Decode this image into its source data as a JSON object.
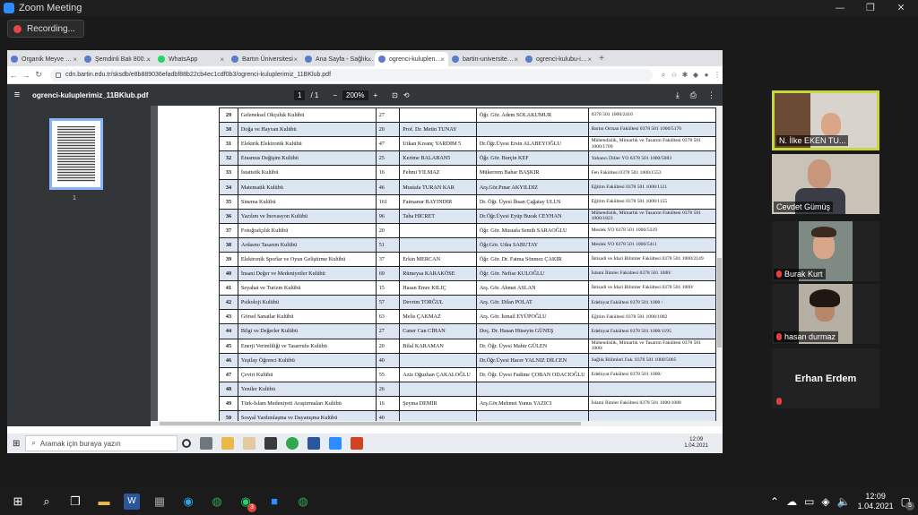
{
  "zoom": {
    "title": "Zoom Meeting",
    "recording": "Recording...",
    "window_controls": [
      "—",
      "❐",
      "✕"
    ]
  },
  "browser": {
    "tabs": [
      {
        "label": "Organik Meyve …"
      },
      {
        "label": "Şemdinli Balı 800…"
      },
      {
        "label": "WhatsApp"
      },
      {
        "label": "Bartın Üniversitesi"
      },
      {
        "label": "Ana Sayfa - Sağlık…"
      },
      {
        "label": "ogrenci-kuluplen…"
      },
      {
        "label": "bartin-universite…"
      },
      {
        "label": "ogrenci-kulubu-i…"
      }
    ],
    "url": "cdn.bartin.edu.tr/sksdb/e8b889036efadbf88b22cb4ec1cdf0b3/ogrenci-kuluplerimiz_11BKlub.pdf"
  },
  "pdf": {
    "filename": "ogrenci-kuluplerimiz_11BKlub.pdf",
    "page_current": "1",
    "page_total": "/ 1",
    "zoom": "200%",
    "thumb_label": "1",
    "rows": [
      {
        "no": "29",
        "club": "Geleneksel Okçuluk Kulübü",
        "members": "27",
        "president": "",
        "advisor": "Öğr. Gör. Adem SOLAKUMUR",
        "faculty": "0378 501 1000/2416"
      },
      {
        "no": "30",
        "club": "Doğa ve Hayvan Kulübü",
        "members": "20",
        "president": "Prof. Dr. Metin TUNAY",
        "advisor": "",
        "faculty": "Bartın Orman Fakültesi 0378 501 1000/5170"
      },
      {
        "no": "31",
        "club": "Elektrik Elektronik Kulübü",
        "members": "47",
        "president": "Utkan Kıvanç YARDIM 5",
        "advisor": "Dr.Öğr.Üyesi Ersin ALABEYOĞLU",
        "faculty": "Mühendislik, Mimarlık ve Tasarım Fakültesi 0378 501 1000/1709"
      },
      {
        "no": "32",
        "club": "Erasmus Değişim Kulübü",
        "members": "25",
        "president": "Kerime BALABAN5",
        "advisor": "Öğr. Gör. Burçin KEF",
        "faculty": "Yabancı Diller YO 0378 501 1000/5083"
      },
      {
        "no": "33",
        "club": "İstatistik Kulübü",
        "members": "16",
        "president": "Fehmi YILMAZ",
        "advisor": "Mükerrem Bahar BAŞKIR",
        "faculty": "Fen Fakültesi 0378 501 1000/1553"
      },
      {
        "no": "34",
        "club": "Matematik Kulübü",
        "members": "46",
        "president": "Mustafa TURAN KAR",
        "advisor": "Arş.Gör.Pınar AKYILDIZ",
        "faculty": "Eğitim Fakültesi 0378 501 1000/1121"
      },
      {
        "no": "35",
        "club": "Sinema Kulübü",
        "members": "161",
        "president": "Fatmanur BAYINDIR",
        "advisor": "Dr. Öğr. Üyesi İhsan Çağatay ULUS",
        "faculty": "Eğitim Fakültesi 0378 501 1000/1155"
      },
      {
        "no": "36",
        "club": "Yazılım ve İnovasyon Kulübü",
        "members": "96",
        "president": "Taha HİCRET",
        "advisor": "Dr.Öğr.Üyesi Eyüp Burak CEYHAN",
        "faculty": "Mühendislik, Mimarlık ve Tasarım Fakültesi 0378 501 1000/1823"
      },
      {
        "no": "37",
        "club": "Fotoğrafçılık Kulübü",
        "members": "20",
        "president": "",
        "advisor": "Öğr. Gör. Mustafa Semih SARAOĞLU",
        "faculty": "Meslek YO 0378 501 1000/5339"
      },
      {
        "no": "38",
        "club": "Ardasno Tasarım Kulübü",
        "members": "51",
        "president": "",
        "advisor": "Öğr.Gör. Utku SABUTAY",
        "faculty": "Meslek YO 0378 501 1000/5411"
      },
      {
        "no": "39",
        "club": "Elektronik Sporlar ve Oyun Geliştirme Kulübü",
        "members": "37",
        "president": "Erkin MERCAN",
        "advisor": "Öğr. Gör. Dr. Fatma Sönmez ÇAKIR",
        "faculty": "İktisadi ve İdari Bilimler Fakültesi 0378 501 1000/2149"
      },
      {
        "no": "40",
        "club": "İnsani Değer ve Medeniyetler Kulübü",
        "members": "69",
        "president": "Rümeysa KARAKÖSE",
        "advisor": "Öğr. Gör. Nefise KULOĞLU",
        "faculty": "İslami İlimler Fakültesi 0378 501 1000/"
      },
      {
        "no": "41",
        "club": "Seyahat ve Turizm Kulübü",
        "members": "15",
        "president": "Hasan Emre KILIÇ",
        "advisor": "Arş. Gör. Ahmet ASLAN",
        "faculty": "İktisadi ve İdari Bilimler Fakültesi 0378 501 1000/"
      },
      {
        "no": "42",
        "club": "Psikoloji Kulübü",
        "members": "57",
        "president": "Devrim TORĞUL",
        "advisor": "Arş. Gör. Dilan POLAT",
        "faculty": "Edebiyat Fakültesi 0378 501 1000 /"
      },
      {
        "no": "43",
        "club": "Görsel Sanatlar Kulübü",
        "members": "63",
        "president": "Melis ÇAKMAZ",
        "advisor": "Arş. Gör. İsmail EYÜPOĞLU",
        "faculty": "Eğitim Fakültesi 0378 501 1000/1082"
      },
      {
        "no": "44",
        "club": "Bilgi ve Değerler Kulübü",
        "members": "27",
        "president": "Caner Can CİHAN",
        "advisor": "Doç. Dr. Hasan Hüseyin GÜNEŞ",
        "faculty": "Edebiyat Fakültesi 0378 501 1000/1195"
      },
      {
        "no": "45",
        "club": "Enerji Verimliliği ve Tasarrufu Kulübü",
        "members": "20",
        "president": "Bilal KARAMAN",
        "advisor": "Dr. Öğr. Üyesi Mahir GÜLEN",
        "faculty": "Mühendislik, Mimarlık ve Tasarım Fakültesi 0378 501 1000/"
      },
      {
        "no": "46",
        "club": "Yeşilay Öğrenci Kulübü",
        "members": "40",
        "president": "",
        "advisor": "Dr.Öğr.Üyesi Hacer YALNIZ DİLCEN",
        "faculty": "Sağlık Bilimleri Fak. 0378 501 1000/5005"
      },
      {
        "no": "47",
        "club": "Çeviri Kulübü",
        "members": "55",
        "president": "Aziz Oğuzhan ÇAKALOĞLU",
        "advisor": "Dr. Öğr. Üyesi Fadime ÇOBAN ODACIOĞLU",
        "faculty": "Edebiyat Fakültesi 0378 501 1000/"
      },
      {
        "no": "48",
        "club": "Yeniler Kulübü",
        "members": "26",
        "president": "",
        "advisor": "",
        "faculty": ""
      },
      {
        "no": "49",
        "club": "Türk-İslam Medeniyeti Araştırmaları Kulübü",
        "members": "16",
        "president": "Şeyma DEMİR",
        "advisor": "Arş.Gör.Mehmet Yunus YAZICI",
        "faculty": "İslami İlimler Fakültesi 0378 501 1000/1088"
      },
      {
        "no": "50",
        "club": "Sosyal Yardımlaşma ve Dayanışma Kulübü",
        "members": "40",
        "president": "",
        "advisor": "",
        "faculty": ""
      }
    ]
  },
  "inner_taskbar": {
    "search_placeholder": "Aramak için buraya yazın",
    "time": "12:09",
    "date": "1.04.2021"
  },
  "participants": [
    {
      "name": "N. İlke EKEN TU...",
      "muted": false
    },
    {
      "name": "Cevdet Gümüş",
      "muted": false
    },
    {
      "name": "Burak Kurt",
      "muted": true
    },
    {
      "name": "hasan durmaz",
      "muted": true
    },
    {
      "name": "Erhan Erdem",
      "muted": true
    }
  ],
  "taskbar": {
    "time": "12:09",
    "date": "1.04.2021",
    "notifications": "5",
    "whatsapp_badge": "3"
  },
  "colors": {
    "zoom_active_speaker": "#c7d63a",
    "table_alt_row": "#dce6f2",
    "pdf_toolbar": "#323639"
  }
}
